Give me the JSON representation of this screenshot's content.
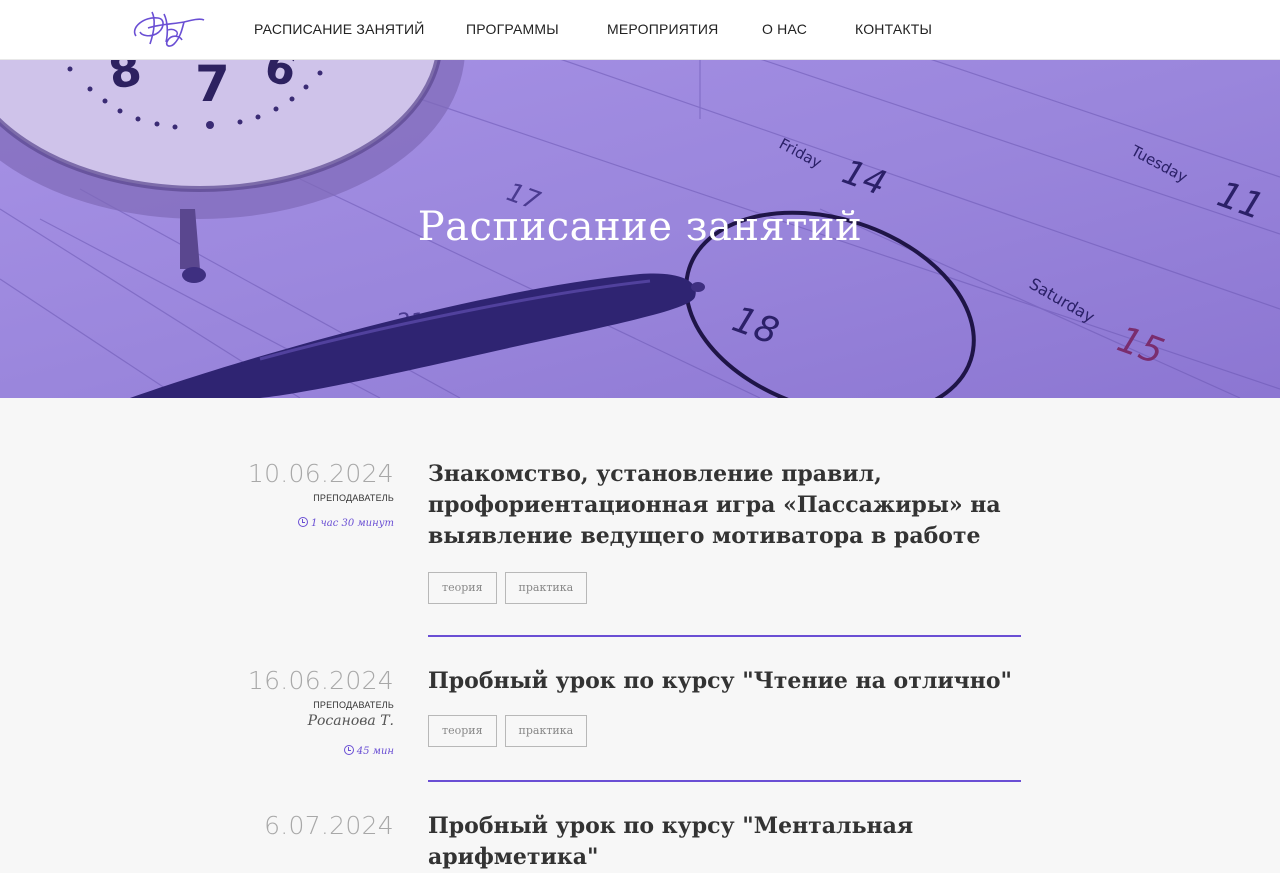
{
  "header": {
    "logo_text": "НТ",
    "nav": [
      {
        "label": "РАСПИСАНИЕ ЗАНЯТИЙ"
      },
      {
        "label": "ПРОГРАММЫ"
      },
      {
        "label": "МЕРОПРИЯТИЯ"
      },
      {
        "label": "О НАС"
      },
      {
        "label": "КОНТАКТЫ"
      }
    ]
  },
  "hero": {
    "title": "Расписание занятий",
    "overlay_color": "#8f78d8",
    "calendar_text": {
      "friday": "Friday",
      "day14": "14",
      "tuesday": "Tuesday",
      "day11": "11",
      "day17": "17",
      "day18": "18",
      "saturday": "Saturday",
      "day15": "15",
      "day21": "21",
      "clock_8": "8",
      "clock_7": "7",
      "clock_6": "6"
    }
  },
  "colors": {
    "accent": "#6a4fd4",
    "background": "#f7f7f7"
  },
  "schedule": {
    "teacher_label": "ПРЕПОДАВАТЕЛЬ",
    "entries": [
      {
        "date": "10.06.2024",
        "teacher": "",
        "duration": "1 час 30 минут",
        "title": "Знакомство, установление правил, профориентационная игра «Пассажиры» на выявление ведущего мотиватора в работе",
        "tags": [
          "теория",
          "практика"
        ]
      },
      {
        "date": "16.06.2024",
        "teacher": "Росанова Т.",
        "duration": "45 мин",
        "title": "Пробный урок по курсу \"Чтение на отлично\"",
        "tags": [
          "теория",
          "практика"
        ]
      },
      {
        "date": "6.07.2024",
        "teacher": "",
        "duration": "",
        "title": "Пробный урок по курсу \"Ментальная арифметика\"",
        "tags": []
      }
    ]
  }
}
